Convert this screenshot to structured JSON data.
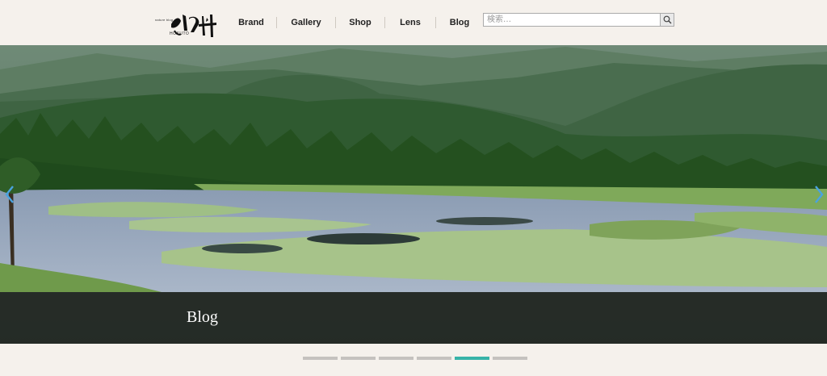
{
  "logo": {
    "main_text": "北斗",
    "sub_text": "nature blog",
    "brand_text": "HOKUTO"
  },
  "nav": {
    "items": [
      {
        "label": "Brand"
      },
      {
        "label": "Gallery"
      },
      {
        "label": "Shop"
      },
      {
        "label": "Lens"
      },
      {
        "label": "Blog"
      }
    ]
  },
  "search": {
    "placeholder": "検索…",
    "icon": "search-icon"
  },
  "hero": {
    "caption": "Blog",
    "prev_icon": "chevron-left-icon",
    "next_icon": "chevron-right-icon",
    "arrow_color": "#4aa3e0"
  },
  "slider": {
    "count": 6,
    "active_index": 4,
    "active_color": "#37b3a8",
    "inactive_color": "#c5c2bf"
  }
}
